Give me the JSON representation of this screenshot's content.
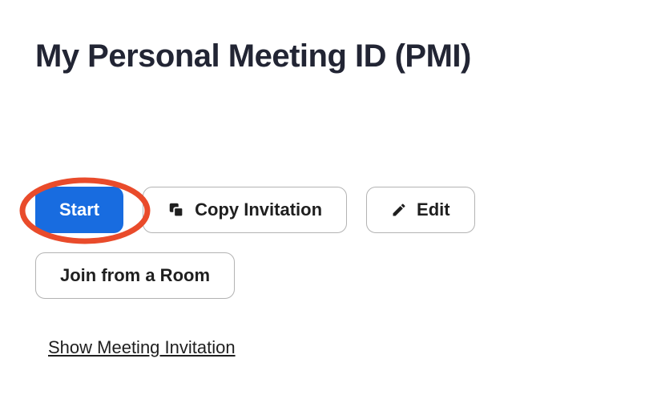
{
  "title": "My Personal Meeting ID (PMI)",
  "buttons": {
    "start": "Start",
    "copy_invitation": "Copy Invitation",
    "edit": "Edit",
    "join_from_room": "Join from a Room"
  },
  "links": {
    "show_invitation": "Show Meeting Invitation"
  },
  "colors": {
    "primary": "#186ce0",
    "highlight": "#e94b2b",
    "title": "#222534"
  }
}
